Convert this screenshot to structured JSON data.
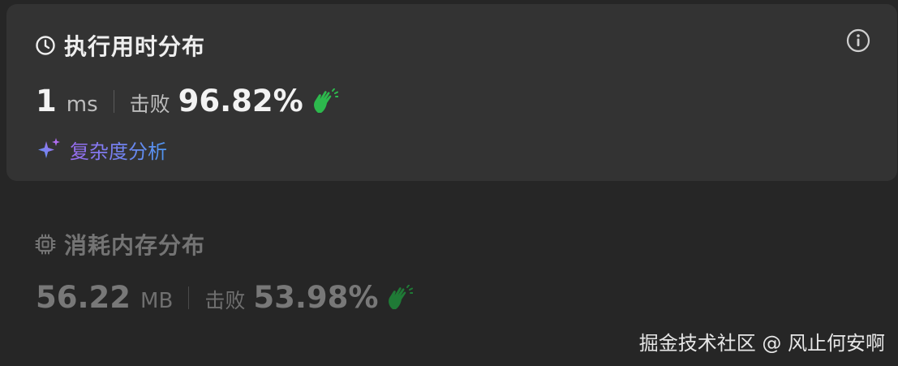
{
  "runtime": {
    "title": "执行用时分布",
    "value": "1",
    "unit": "ms",
    "beats_label": "击败",
    "beats_percent": "96.82%",
    "analysis_link": "复杂度分析"
  },
  "memory": {
    "title": "消耗内存分布",
    "value": "56.22",
    "unit": "MB",
    "beats_label": "击败",
    "beats_percent": "53.98%"
  },
  "watermark": "掘金技术社区 @ 风止何安啊",
  "icons": {
    "runtime": "clock-icon",
    "info": "info-icon",
    "clap": "clap-icon",
    "sparkle": "sparkle-icon",
    "memory": "chip-icon"
  },
  "colors": {
    "background": "#262626",
    "card": "#333333",
    "clap_green": "#2db94d",
    "link_purple": "#9a6cf0",
    "link_blue": "#4f96f0"
  }
}
